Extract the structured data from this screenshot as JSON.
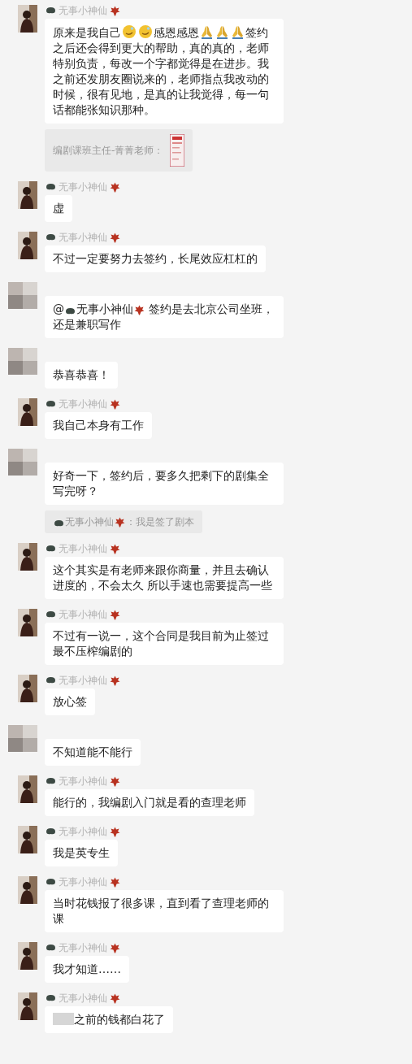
{
  "messages": [
    {
      "kind": "self",
      "name": "无事小神仙",
      "parts": [
        {
          "kind": "text",
          "text": "原来是我自己"
        },
        {
          "kind": "sweat-emoji"
        },
        {
          "kind": "sweat-emoji"
        },
        {
          "kind": "text",
          "text": "感恩感恩"
        },
        {
          "kind": "pray-emoji"
        },
        {
          "kind": "pray-emoji"
        },
        {
          "kind": "pray-emoji"
        },
        {
          "kind": "text",
          "text": "签约之后还会得到更大的帮助，真的真的，老师特别负责，每改一个字都觉得是在进步。我之前还发朋友圈说来的，老师指点我改动的时候，很有见地，是真的让我觉得，每一句话都能张知识那种。"
        }
      ],
      "quote": {
        "parts": [
          {
            "kind": "text",
            "text": "编剧课班主任-菁菁老师："
          },
          {
            "kind": "thumbnail"
          }
        ]
      }
    },
    {
      "kind": "self",
      "name": "无事小神仙",
      "parts": [
        {
          "kind": "text",
          "text": "虚"
        }
      ]
    },
    {
      "kind": "self",
      "name": "无事小神仙",
      "parts": [
        {
          "kind": "text",
          "text": "不过一定要努力去签约，长尾效应杠杠的"
        }
      ]
    },
    {
      "kind": "other",
      "parts": [
        {
          "kind": "text",
          "text": "@"
        },
        {
          "kind": "name",
          "text": "无事小神仙"
        },
        {
          "kind": "text",
          "text": " 签约是去北京公司坐班，还是兼职写作"
        }
      ]
    },
    {
      "kind": "other",
      "parts": [
        {
          "kind": "text",
          "text": "恭喜恭喜！"
        }
      ]
    },
    {
      "kind": "self",
      "name": "无事小神仙",
      "parts": [
        {
          "kind": "text",
          "text": "我自己本身有工作"
        }
      ]
    },
    {
      "kind": "other",
      "parts": [
        {
          "kind": "text",
          "text": "好奇一下，签约后，要多久把剩下的剧集全写完呀？"
        }
      ],
      "quote": {
        "parts": [
          {
            "kind": "name",
            "text": "无事小神仙"
          },
          {
            "kind": "text",
            "text": "：我是签了剧本"
          }
        ]
      }
    },
    {
      "kind": "self",
      "name": "无事小神仙",
      "parts": [
        {
          "kind": "text",
          "text": "这个其实是有老师来跟你商量，并且去确认进度的，不会太久 所以手速也需要提高一些"
        }
      ]
    },
    {
      "kind": "self",
      "name": "无事小神仙",
      "parts": [
        {
          "kind": "text",
          "text": "不过有一说一，这个合同是我目前为止签过最不压榨编剧的"
        }
      ]
    },
    {
      "kind": "self",
      "name": "无事小神仙",
      "parts": [
        {
          "kind": "text",
          "text": "放心签"
        }
      ]
    },
    {
      "kind": "other",
      "parts": [
        {
          "kind": "text",
          "text": "不知道能不能行"
        }
      ]
    },
    {
      "kind": "self",
      "name": "无事小神仙",
      "parts": [
        {
          "kind": "text",
          "text": "能行的，我编剧入门就是看的查理老师"
        }
      ]
    },
    {
      "kind": "self",
      "name": "无事小神仙",
      "parts": [
        {
          "kind": "text",
          "text": "我是英专生"
        }
      ]
    },
    {
      "kind": "self",
      "name": "无事小神仙",
      "parts": [
        {
          "kind": "text",
          "text": "当时花钱报了很多课，直到看了查理老师的课"
        }
      ]
    },
    {
      "kind": "self",
      "name": "无事小神仙",
      "parts": [
        {
          "kind": "text",
          "text": "我才知道……"
        }
      ]
    },
    {
      "kind": "self",
      "name": "无事小神仙",
      "parts": [
        {
          "kind": "redacted"
        },
        {
          "kind": "text",
          "text": "之前的钱都白花了"
        }
      ]
    }
  ]
}
